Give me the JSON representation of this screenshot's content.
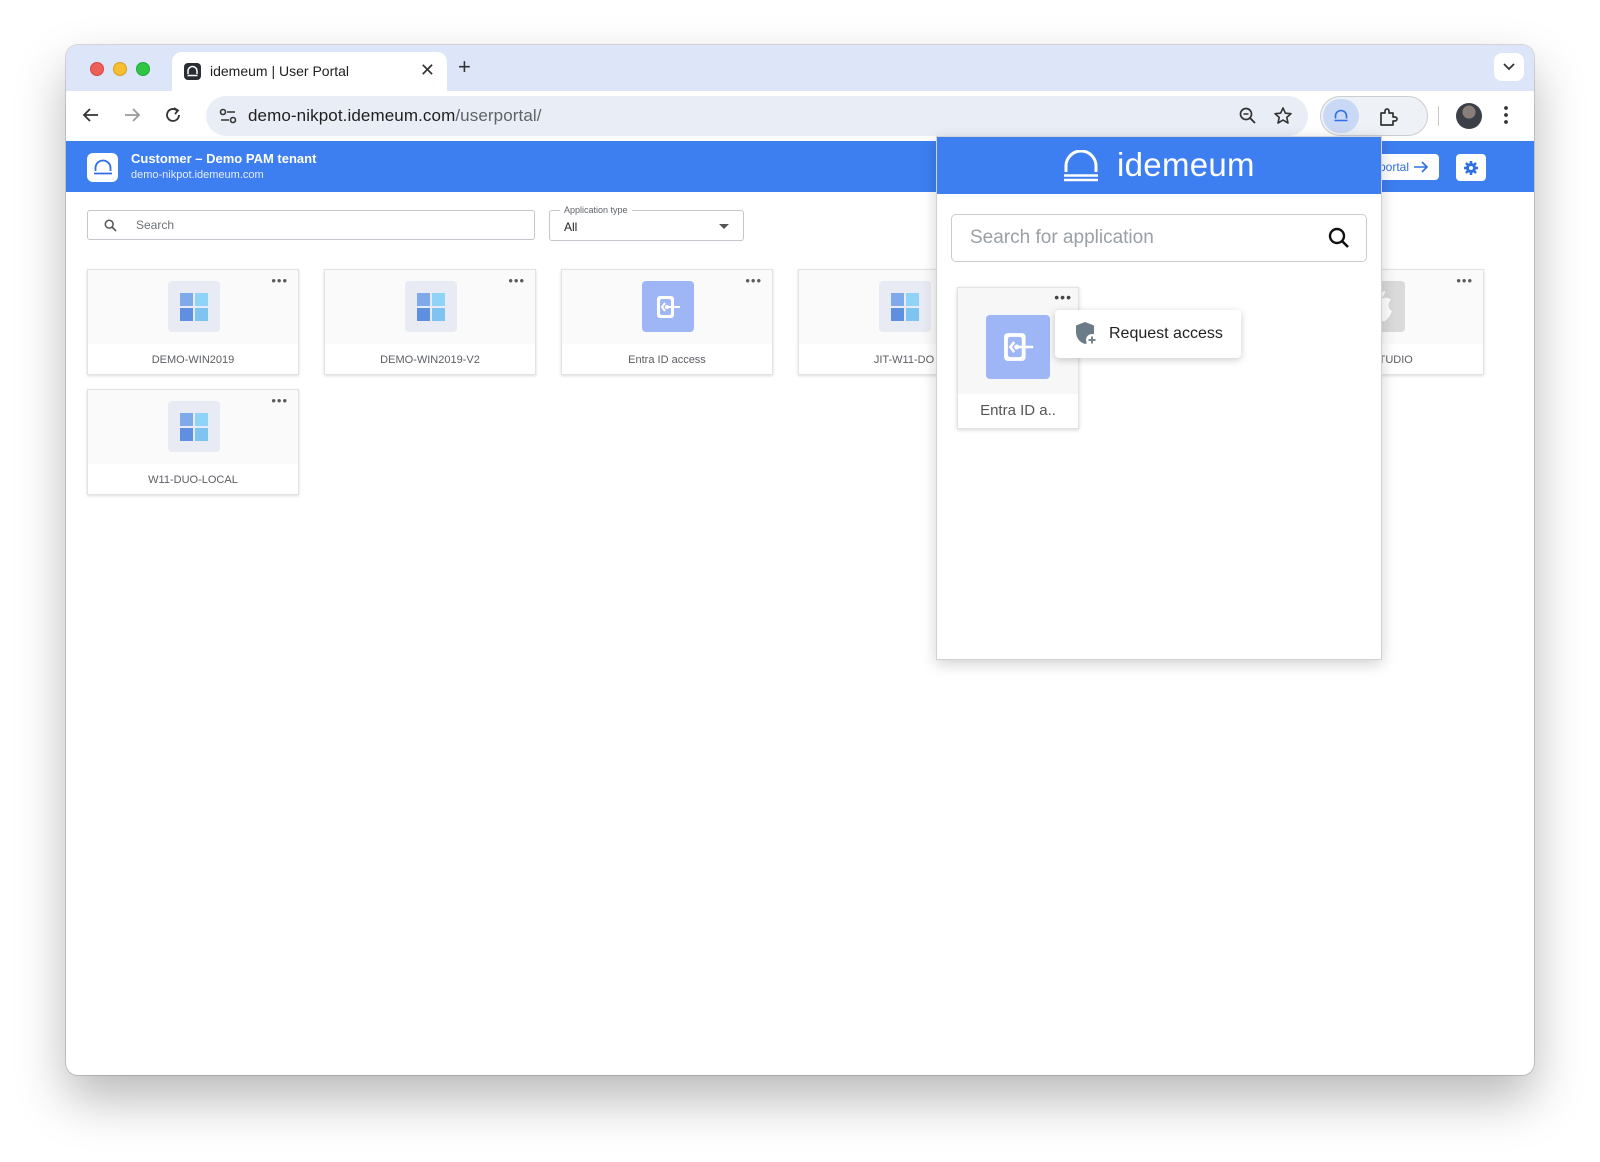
{
  "browser": {
    "tab_title": "idemeum | User Portal",
    "tab_close": "✕",
    "new_tab": "+",
    "url_domain": "demo-nikpot.idemeum.com",
    "url_path": "/userportal/"
  },
  "header": {
    "tenant_name": "Customer – Demo PAM tenant",
    "tenant_domain": "demo-nikpot.idemeum.com",
    "admin_portal_label": "min portal"
  },
  "filters": {
    "search_placeholder": "Search",
    "application_type_label": "Application type",
    "application_type_value": "All"
  },
  "apps": [
    {
      "label": "DEMO-WIN2019",
      "icon": "windows-icon"
    },
    {
      "label": "DEMO-WIN2019-V2",
      "icon": "windows-icon"
    },
    {
      "label": "Entra ID access",
      "icon": "entra-id-icon"
    },
    {
      "label": "JIT-W11-DO",
      "icon": "windows-icon"
    },
    {
      "label": "MAC-STUDIO",
      "icon": "apple-icon"
    },
    {
      "label": "W11-DUO-LOCAL",
      "icon": "windows-icon"
    }
  ],
  "card_menu": "•••",
  "extension_popup": {
    "brand": "idemeum",
    "search_placeholder": "Search for application",
    "app_card_label": "Entra ID a..",
    "context_menu_item": "Request access"
  },
  "colors": {
    "brand_blue": "#3d7ef0",
    "tab_strip": "#dde6f8",
    "entra_tile": "#9eb5f6"
  }
}
